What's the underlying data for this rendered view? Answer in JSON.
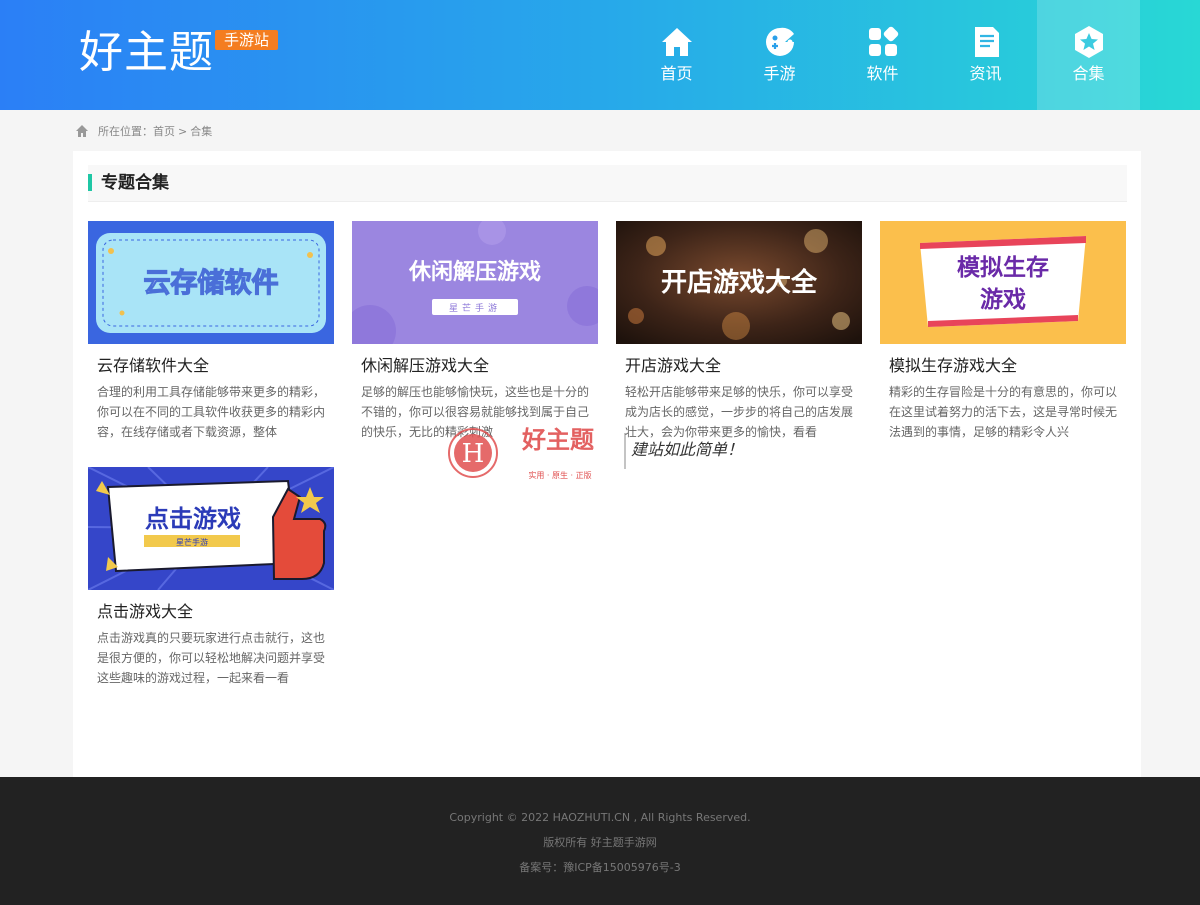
{
  "header": {
    "logo": "好主题",
    "badge": "手游站",
    "nav": [
      {
        "label": "首页",
        "icon": "home-icon"
      },
      {
        "label": "手游",
        "icon": "gamepad-icon"
      },
      {
        "label": "软件",
        "icon": "apps-icon"
      },
      {
        "label": "资讯",
        "icon": "news-icon"
      },
      {
        "label": "合集",
        "icon": "collection-icon",
        "active": true
      }
    ]
  },
  "breadcrumb": {
    "prefix": "所在位置：",
    "home": "首页",
    "sep": ">",
    "current": "合集"
  },
  "section": {
    "title": "专题合集"
  },
  "cards": [
    {
      "thumb_text": "云存储软件",
      "title": "云存储软件大全",
      "desc": "合理的利用工具存储能够带来更多的精彩，你可以在不同的工具软件收获更多的精彩内容，在线存储或者下载资源，整体"
    },
    {
      "thumb_text": "休闲解压游戏",
      "thumb_sub": "星芒手游",
      "title": "休闲解压游戏大全",
      "desc": "足够的解压也能够愉快玩，这些也是十分的不错的，你可以很容易就能够找到属于自己的快乐，无比的精彩刺激"
    },
    {
      "thumb_text": "开店游戏大全",
      "title": "开店游戏大全",
      "desc": "轻松开店能够带来足够的快乐，你可以享受成为店长的感觉，一步步的将自己的店发展壮大，会为你带来更多的愉快，看看"
    },
    {
      "thumb_text": "模拟生存",
      "thumb_text2": "游戏",
      "title": "模拟生存游戏大全",
      "desc": "精彩的生存冒险是十分的有意思的，你可以在这里试着努力的活下去，这是寻常时候无法遇到的事情，足够的精彩令人兴"
    },
    {
      "thumb_text": "点击游戏",
      "thumb_sub": "星芒手游",
      "title": "点击游戏大全",
      "desc": "点击游戏真的只要玩家进行点击就行，这也是很方便的，你可以轻松地解决问题并享受这些趣味的游戏过程，一起来看一看"
    }
  ],
  "watermark": {
    "letter": "H",
    "brand": "好主题",
    "tagline": "实用 · 原生 · 正版",
    "slogan": "建站如此简单！"
  },
  "footer": {
    "copyright": "Copyright © 2022 HAOZHUTI.CN , All Rights Reserved.",
    "owner": "版权所有 好主题手游网",
    "icp_prefix": "备案号：",
    "icp": "豫ICP备15005976号-3"
  },
  "colors": {
    "accent": "#1fc7a5",
    "badge": "#f47d20",
    "footer_bg": "#222222"
  }
}
